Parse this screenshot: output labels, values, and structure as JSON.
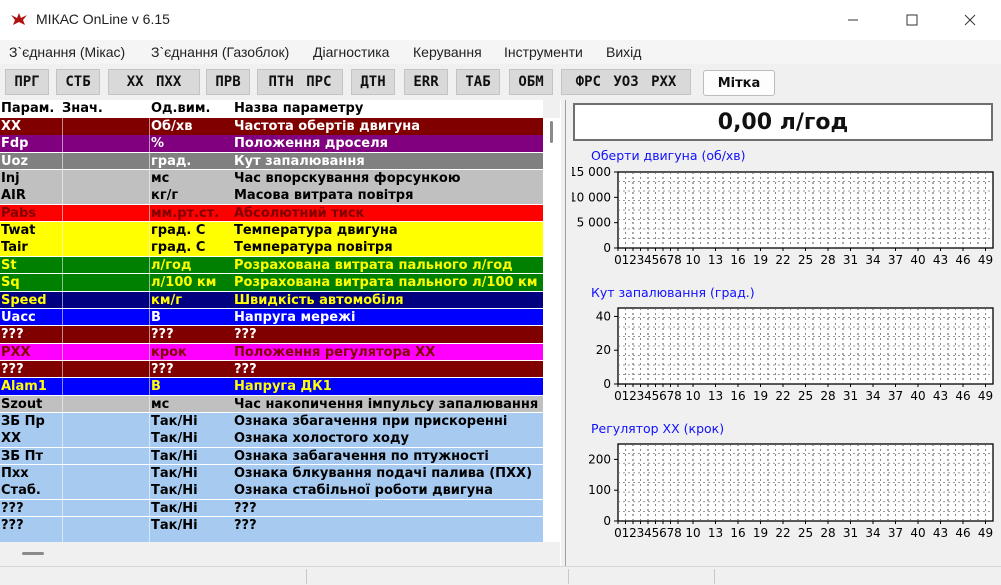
{
  "window": {
    "title": "МІКАС OnLine v 6.15"
  },
  "menu": [
    "З`єднання (Мікас)",
    "З`єднання (Газоблок)",
    "Діагностика",
    "Керування",
    "Інструменти",
    "Вихід"
  ],
  "toolbar": [
    "ПРГ",
    "СТБ",
    "ХХ  ПХХ",
    "ПРВ",
    "ПТН  ПРС",
    "ДТН",
    "ERR",
    "ТАБ",
    "ОБМ",
    "ФРС  УОЗ  РХХ",
    "Мітка"
  ],
  "table": {
    "headers": [
      "Парам.",
      "Знач.",
      "Од.вим.",
      "Назва параметру"
    ],
    "rows": [
      {
        "param": "XX",
        "value": "",
        "unit": "Об/хв",
        "name": "Частота обертів двигуна",
        "bg": "#800000",
        "fg": "#ffffff"
      },
      {
        "param": "Fdp",
        "value": "",
        "unit": "%",
        "name": "Положення дроселя",
        "bg": "#800080",
        "fg": "#ffffff"
      },
      {
        "param": "Uoz",
        "value": "",
        "unit": "град.",
        "name": "Кут запалювання",
        "bg": "#808080",
        "fg": "#ffffff"
      },
      {
        "param": "Inj",
        "value": "",
        "unit": "мс",
        "name": "Час впорскування форсункою",
        "bg": "#c0c0c0",
        "fg": "#000000"
      },
      {
        "param": "AIR",
        "value": "",
        "unit": "кг/г",
        "name": "Масова витрата повітря",
        "bg": "#c0c0c0",
        "fg": "#000000"
      },
      {
        "param": "Pabs",
        "value": "",
        "unit": "мм.рт.ст.",
        "name": "Абсолютний тиск",
        "bg": "#ff0000",
        "fg": "#800000"
      },
      {
        "param": "Twat",
        "value": "",
        "unit": "град. С",
        "name": "Температура двигуна",
        "bg": "#ffff00",
        "fg": "#000000"
      },
      {
        "param": "Tair",
        "value": "",
        "unit": "град. С",
        "name": "Температура повітря",
        "bg": "#ffff00",
        "fg": "#000000"
      },
      {
        "param": "St",
        "value": "",
        "unit": "л/год",
        "name": "Розрахована витрата пального л/год",
        "bg": "#008000",
        "fg": "#ffff00"
      },
      {
        "param": "Sq",
        "value": "",
        "unit": "л/100 км",
        "name": "Розрахована витрата пального л/100 км",
        "bg": "#008000",
        "fg": "#ffff00"
      },
      {
        "param": "Speed",
        "value": "",
        "unit": "км/г",
        "name": "Швидкість автомобіля",
        "bg": "#000080",
        "fg": "#ffff00"
      },
      {
        "param": "Uacc",
        "value": "",
        "unit": "В",
        "name": "Напруга мережі",
        "bg": "#0000ff",
        "fg": "#ffffff"
      },
      {
        "param": "???",
        "value": "",
        "unit": "???",
        "name": "???",
        "bg": "#800000",
        "fg": "#ffffff"
      },
      {
        "param": "PXX",
        "value": "",
        "unit": "крок",
        "name": "Положення регулятора ХХ",
        "bg": "#ff00ff",
        "fg": "#800000"
      },
      {
        "param": "???",
        "value": "",
        "unit": "???",
        "name": "???",
        "bg": "#800000",
        "fg": "#ffffff"
      },
      {
        "param": "Alam1",
        "value": "",
        "unit": "В",
        "name": "Напруга ДК1",
        "bg": "#0000ff",
        "fg": "#ffff00"
      },
      {
        "param": "Szout",
        "value": "",
        "unit": "мс",
        "name": "Час накопичення імпульсу запалювання",
        "bg": "#c0c0c0",
        "fg": "#000000"
      },
      {
        "param": "ЗБ Пр",
        "value": "",
        "unit": "Так/Ні",
        "name": "Ознака збагачення при прискоренні",
        "bg": "#a6caf0",
        "fg": "#000000"
      },
      {
        "param": "XX",
        "value": "",
        "unit": "Так/Ні",
        "name": "Ознака холостого ходу",
        "bg": "#a6caf0",
        "fg": "#000000"
      },
      {
        "param": "ЗБ Пт",
        "value": "",
        "unit": "Так/Ні",
        "name": "Ознака забагачення по птужності",
        "bg": "#a6caf0",
        "fg": "#000000"
      },
      {
        "param": "Пхх",
        "value": "",
        "unit": "Так/Ні",
        "name": "Ознака блкування подачі палива (ПХХ)",
        "bg": "#a6caf0",
        "fg": "#000000"
      },
      {
        "param": "Стаб.",
        "value": "",
        "unit": "Так/Ні",
        "name": "Ознака стабільної роботи двигуна",
        "bg": "#a6caf0",
        "fg": "#000000"
      },
      {
        "param": "???",
        "value": "",
        "unit": "Так/Ні",
        "name": "???",
        "bg": "#a6caf0",
        "fg": "#000000"
      },
      {
        "param": "???",
        "value": "",
        "unit": "Так/Ні",
        "name": "???",
        "bg": "#a6caf0",
        "fg": "#000000"
      },
      {
        "param": "",
        "value": "",
        "unit": "",
        "name": "",
        "bg": "#a6caf0",
        "fg": "#000000"
      }
    ]
  },
  "fuel_readout": "0,00 л/год",
  "chart_data": [
    {
      "type": "line",
      "title": "Оберти двигуна (об/хв)",
      "ylim": [
        0,
        15000
      ],
      "yticks": [
        "15 000",
        "10 000",
        "5 000",
        "0"
      ],
      "ytick_values": [
        15000,
        10000,
        5000,
        0
      ],
      "xticks": [
        "0",
        "1",
        "2",
        "3",
        "4",
        "5",
        "6",
        "7",
        "8",
        "10",
        "13",
        "16",
        "19",
        "22",
        "25",
        "28",
        "31",
        "34",
        "37",
        "40",
        "43",
        "46",
        "49"
      ],
      "xtick_values": [
        0,
        1,
        2,
        3,
        4,
        5,
        6,
        7,
        8,
        10,
        13,
        16,
        19,
        22,
        25,
        28,
        31,
        34,
        37,
        40,
        43,
        46,
        49
      ],
      "xlim": [
        0,
        50
      ],
      "grid": true,
      "series": []
    },
    {
      "type": "line",
      "title": "Кут запалювання (град.)",
      "ylim": [
        0,
        45
      ],
      "yticks": [
        "40",
        "20",
        "0"
      ],
      "ytick_values": [
        40,
        20,
        0
      ],
      "xticks": [
        "0",
        "1",
        "2",
        "3",
        "4",
        "5",
        "6",
        "7",
        "8",
        "10",
        "13",
        "16",
        "19",
        "22",
        "25",
        "28",
        "31",
        "34",
        "37",
        "40",
        "43",
        "46",
        "49"
      ],
      "xtick_values": [
        0,
        1,
        2,
        3,
        4,
        5,
        6,
        7,
        8,
        10,
        13,
        16,
        19,
        22,
        25,
        28,
        31,
        34,
        37,
        40,
        43,
        46,
        49
      ],
      "xlim": [
        0,
        50
      ],
      "grid": true,
      "series": []
    },
    {
      "type": "line",
      "title": "Регулятор XX (крок)",
      "ylim": [
        0,
        250
      ],
      "yticks": [
        "200",
        "100",
        "0"
      ],
      "ytick_values": [
        200,
        100,
        0
      ],
      "xticks": [
        "0",
        "1",
        "2",
        "3",
        "4",
        "5",
        "6",
        "7",
        "8",
        "10",
        "13",
        "16",
        "19",
        "22",
        "25",
        "28",
        "31",
        "34",
        "37",
        "40",
        "43",
        "46",
        "49"
      ],
      "xtick_values": [
        0,
        1,
        2,
        3,
        4,
        5,
        6,
        7,
        8,
        10,
        13,
        16,
        19,
        22,
        25,
        28,
        31,
        34,
        37,
        40,
        43,
        46,
        49
      ],
      "xlim": [
        0,
        50
      ],
      "grid": true,
      "series": []
    }
  ]
}
